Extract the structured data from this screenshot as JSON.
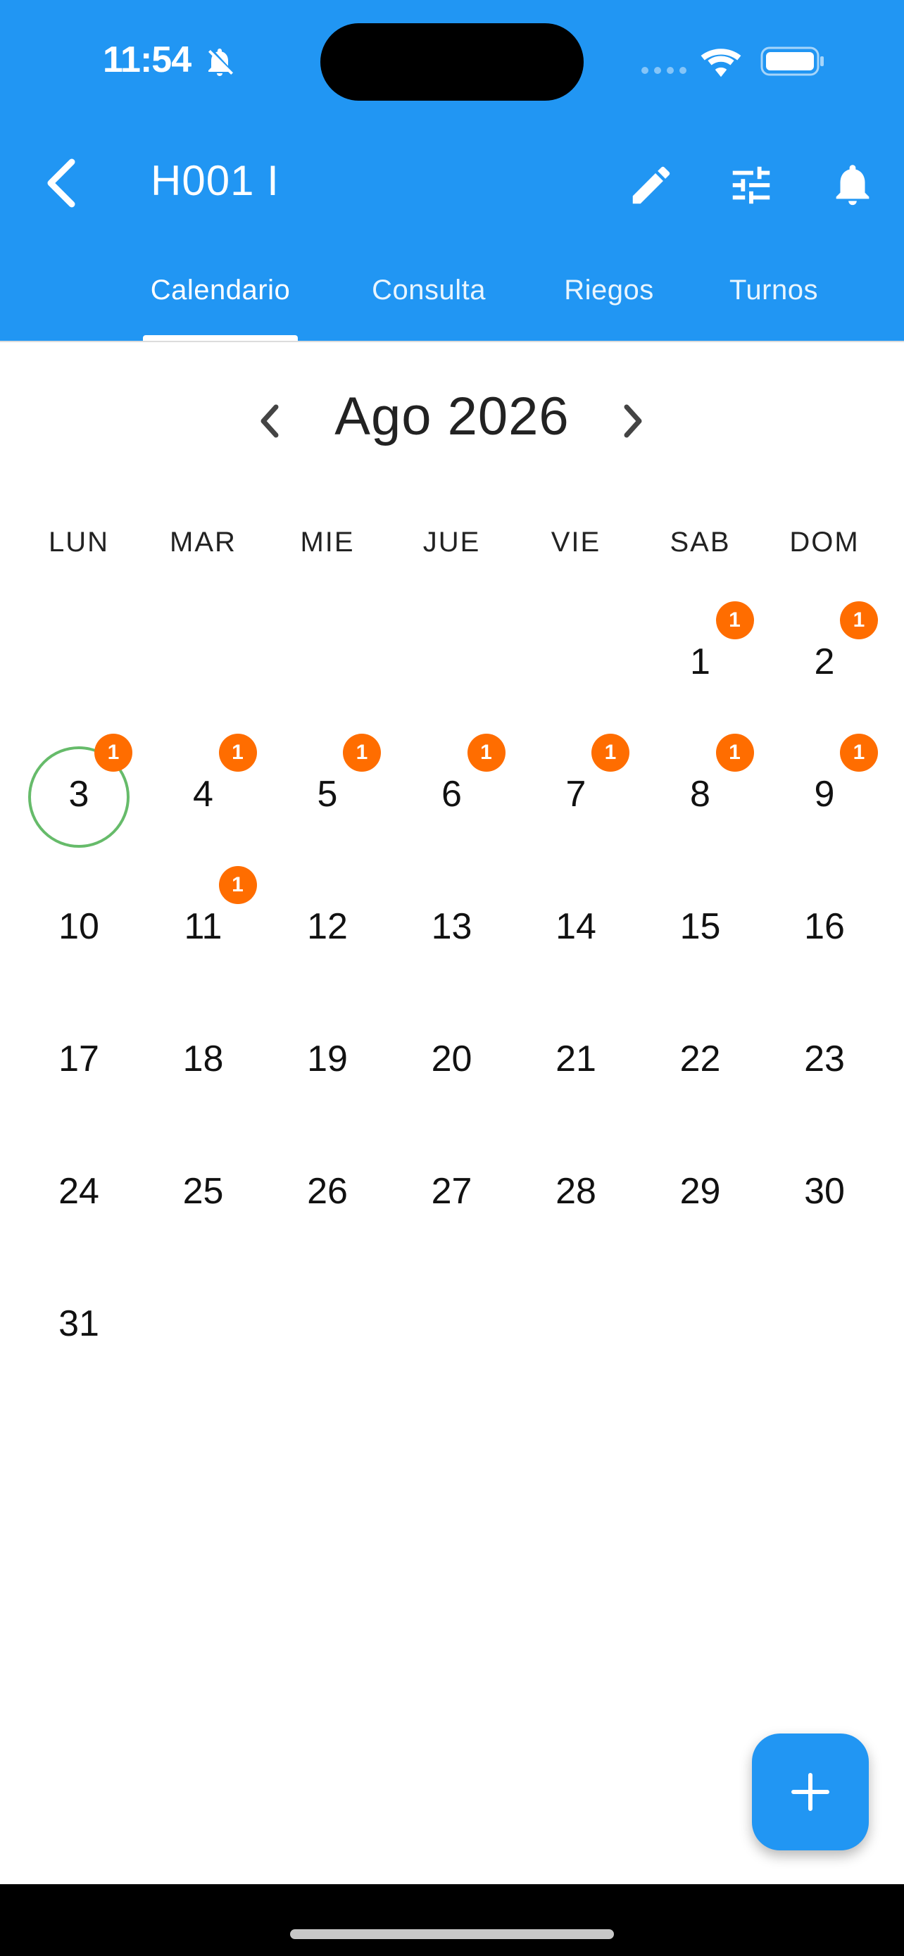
{
  "status_bar": {
    "time": "11:54"
  },
  "app_bar": {
    "title": "H001 I",
    "tabs": [
      {
        "label": "Calendario",
        "active": true
      },
      {
        "label": "Consulta",
        "active": false
      },
      {
        "label": "Riegos",
        "active": false
      },
      {
        "label": "Turnos",
        "active": false
      }
    ]
  },
  "calendar": {
    "month_label": "Ago 2026",
    "weekdays": [
      "LUN",
      "MAR",
      "MIE",
      "JUE",
      "VIE",
      "SAB",
      "DOM"
    ],
    "today": "3",
    "badge_color": "#FF6D00",
    "weeks": [
      [
        {
          "day": "",
          "badge": ""
        },
        {
          "day": "",
          "badge": ""
        },
        {
          "day": "",
          "badge": ""
        },
        {
          "day": "",
          "badge": ""
        },
        {
          "day": "",
          "badge": ""
        },
        {
          "day": "1",
          "badge": "1"
        },
        {
          "day": "2",
          "badge": "1"
        }
      ],
      [
        {
          "day": "3",
          "badge": "1"
        },
        {
          "day": "4",
          "badge": "1"
        },
        {
          "day": "5",
          "badge": "1"
        },
        {
          "day": "6",
          "badge": "1"
        },
        {
          "day": "7",
          "badge": "1"
        },
        {
          "day": "8",
          "badge": "1"
        },
        {
          "day": "9",
          "badge": "1"
        }
      ],
      [
        {
          "day": "10",
          "badge": ""
        },
        {
          "day": "11",
          "badge": "1"
        },
        {
          "day": "12",
          "badge": ""
        },
        {
          "day": "13",
          "badge": ""
        },
        {
          "day": "14",
          "badge": ""
        },
        {
          "day": "15",
          "badge": ""
        },
        {
          "day": "16",
          "badge": ""
        }
      ],
      [
        {
          "day": "17",
          "badge": ""
        },
        {
          "day": "18",
          "badge": ""
        },
        {
          "day": "19",
          "badge": ""
        },
        {
          "day": "20",
          "badge": ""
        },
        {
          "day": "21",
          "badge": ""
        },
        {
          "day": "22",
          "badge": ""
        },
        {
          "day": "23",
          "badge": ""
        }
      ],
      [
        {
          "day": "24",
          "badge": ""
        },
        {
          "day": "25",
          "badge": ""
        },
        {
          "day": "26",
          "badge": ""
        },
        {
          "day": "27",
          "badge": ""
        },
        {
          "day": "28",
          "badge": ""
        },
        {
          "day": "29",
          "badge": ""
        },
        {
          "day": "30",
          "badge": ""
        }
      ],
      [
        {
          "day": "31",
          "badge": ""
        },
        {
          "day": "",
          "badge": ""
        },
        {
          "day": "",
          "badge": ""
        },
        {
          "day": "",
          "badge": ""
        },
        {
          "day": "",
          "badge": ""
        },
        {
          "day": "",
          "badge": ""
        },
        {
          "day": "",
          "badge": ""
        }
      ]
    ]
  },
  "colors": {
    "primary": "#2196F3",
    "today_ring": "#66BB6A",
    "badge": "#FF6D00"
  },
  "icons": [
    "bell-off-icon",
    "signal-icon",
    "wifi-icon",
    "battery-icon",
    "back-arrow-icon",
    "edit-icon",
    "tune-icon",
    "notifications-icon",
    "chevron-left-icon",
    "chevron-right-icon",
    "add-icon"
  ]
}
